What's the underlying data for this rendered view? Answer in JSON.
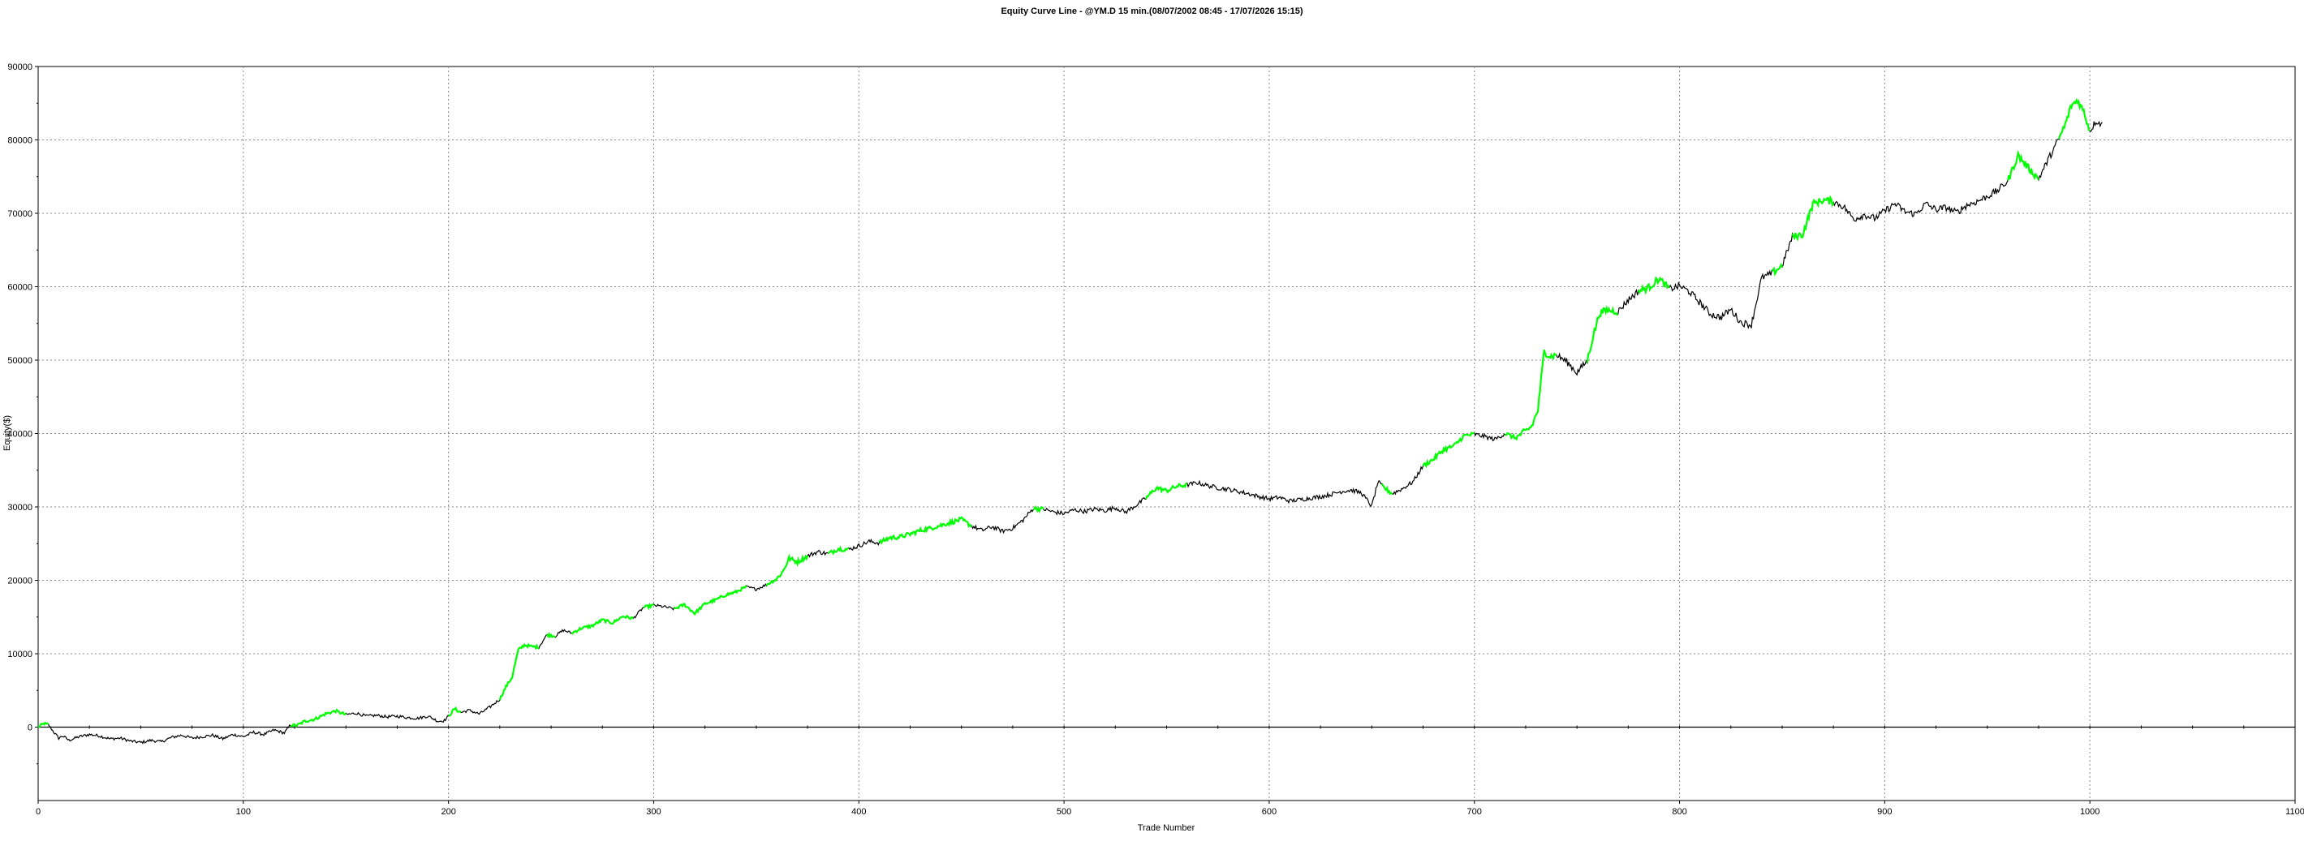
{
  "chart_data": {
    "type": "line",
    "title": "Equity Curve Line - @YM.D 15 min.(08/07/2002 08:45 - 17/07/2026 15:15)",
    "xlabel": "Trade Number",
    "ylabel": "Equity($)",
    "xlim": [
      0,
      1100
    ],
    "ylim": [
      -10000,
      90000
    ],
    "x_ticks": [
      0,
      100,
      200,
      300,
      400,
      500,
      600,
      700,
      800,
      900,
      1000,
      1100
    ],
    "y_ticks": [
      0,
      10000,
      20000,
      30000,
      40000,
      50000,
      60000,
      70000,
      80000,
      90000
    ],
    "grid": true,
    "zero_line": true,
    "line_color": "#000000",
    "highlight_color": "#00ff00",
    "series": [
      {
        "values_x": [
          0,
          3,
          5,
          8,
          10,
          12,
          15,
          20,
          25,
          30,
          35,
          40,
          45,
          50,
          55,
          60,
          65,
          70,
          75,
          80,
          85,
          90,
          95,
          100,
          105,
          110,
          115,
          120,
          123,
          126,
          130,
          135,
          140,
          145,
          150,
          155,
          160,
          165,
          170,
          175,
          180,
          185,
          190,
          195,
          198,
          200,
          203,
          206,
          210,
          215,
          220,
          225,
          228,
          231,
          234,
          237,
          240,
          244,
          248,
          252,
          256,
          260,
          265,
          270,
          275,
          280,
          285,
          290,
          295,
          300,
          305,
          310,
          315,
          320,
          325,
          330,
          335,
          340,
          345,
          350,
          355,
          360,
          363,
          366,
          370,
          375,
          380,
          385,
          390,
          395,
          400,
          405,
          410,
          415,
          420,
          425,
          430,
          435,
          440,
          445,
          450,
          455,
          460,
          465,
          470,
          475,
          480,
          485,
          490,
          495,
          500,
          505,
          510,
          515,
          520,
          525,
          530,
          535,
          540,
          545,
          550,
          555,
          560,
          565,
          570,
          575,
          580,
          585,
          590,
          595,
          600,
          605,
          610,
          615,
          620,
          625,
          630,
          635,
          640,
          645,
          650,
          653,
          656,
          660,
          665,
          670,
          675,
          680,
          685,
          690,
          695,
          700,
          705,
          710,
          715,
          720,
          725,
          728,
          731,
          734,
          737,
          740,
          745,
          750,
          755,
          758,
          761,
          765,
          770,
          775,
          780,
          785,
          790,
          795,
          800,
          805,
          810,
          815,
          820,
          825,
          830,
          835,
          840,
          845,
          850,
          855,
          860,
          865,
          870,
          875,
          880,
          885,
          890,
          895,
          900,
          905,
          910,
          915,
          920,
          925,
          930,
          935,
          940,
          945,
          950,
          955,
          960,
          965,
          970,
          975,
          980,
          985,
          988,
          991,
          994,
          997,
          1000,
          1003,
          1006,
          1010
        ],
        "values_y": [
          0,
          500,
          300,
          -800,
          -1500,
          -1200,
          -1800,
          -1300,
          -1000,
          -1200,
          -1600,
          -1500,
          -1900,
          -2100,
          -1800,
          -2000,
          -1400,
          -1100,
          -1500,
          -1300,
          -1100,
          -1600,
          -1000,
          -1300,
          -700,
          -1000,
          -400,
          -800,
          300,
          200,
          800,
          1100,
          1800,
          2200,
          1700,
          1900,
          1500,
          1600,
          1400,
          1500,
          1300,
          1200,
          1500,
          800,
          900,
          1500,
          2500,
          2000,
          2300,
          1800,
          2700,
          3800,
          5500,
          6800,
          10500,
          11200,
          11000,
          10900,
          12600,
          12400,
          13200,
          12800,
          13500,
          13800,
          14600,
          14200,
          15100,
          14800,
          16300,
          16600,
          16400,
          16100,
          16700,
          15500,
          16800,
          17300,
          18000,
          18400,
          19100,
          18800,
          19400,
          20200,
          21200,
          23000,
          22500,
          23300,
          23900,
          23600,
          24300,
          24200,
          24700,
          25300,
          25100,
          25800,
          25900,
          26300,
          26800,
          27100,
          27500,
          27900,
          28300,
          27400,
          26800,
          27300,
          26700,
          27100,
          28200,
          29800,
          29700,
          29300,
          29100,
          29600,
          29400,
          29700,
          29500,
          29900,
          29300,
          30200,
          31200,
          32600,
          32200,
          32800,
          33000,
          33300,
          32900,
          32600,
          32400,
          32100,
          31800,
          31400,
          31100,
          31300,
          30800,
          31000,
          31200,
          31400,
          31700,
          32100,
          32300,
          31900,
          30100,
          33400,
          32600,
          31800,
          32500,
          33400,
          35600,
          36500,
          37800,
          38300,
          39700,
          39900,
          39600,
          39200,
          40000,
          39400,
          40300,
          41000,
          43200,
          51200,
          50500,
          50700,
          49800,
          48300,
          49900,
          53400,
          56400,
          56800,
          56600,
          58200,
          59400,
          59900,
          61100,
          59700,
          60100,
          59300,
          57800,
          56300,
          55800,
          56900,
          55100,
          54800,
          61200,
          61800,
          62900,
          66800,
          67100,
          71300,
          71800,
          71600,
          70900,
          69200,
          69800,
          69300,
          70300,
          71300,
          70200,
          69900,
          71300,
          70500,
          70800,
          70100,
          71100,
          71600,
          72300,
          73100,
          74400,
          77900,
          76200,
          74700,
          77500,
          80200,
          82100,
          84700,
          85400,
          83900,
          81200,
          82600,
          82100
        ]
      }
    ],
    "highlight_segments": [
      [
        0,
        5
      ],
      [
        123,
        150
      ],
      [
        200,
        206
      ],
      [
        225,
        244
      ],
      [
        248,
        252
      ],
      [
        260,
        290
      ],
      [
        295,
        300
      ],
      [
        310,
        345
      ],
      [
        355,
        375
      ],
      [
        385,
        395
      ],
      [
        410,
        455
      ],
      [
        485,
        490
      ],
      [
        540,
        560
      ],
      [
        655,
        660
      ],
      [
        675,
        700
      ],
      [
        715,
        740
      ],
      [
        755,
        770
      ],
      [
        780,
        795
      ],
      [
        845,
        850
      ],
      [
        855,
        875
      ],
      [
        960,
        975
      ],
      [
        985,
        1000
      ]
    ]
  }
}
